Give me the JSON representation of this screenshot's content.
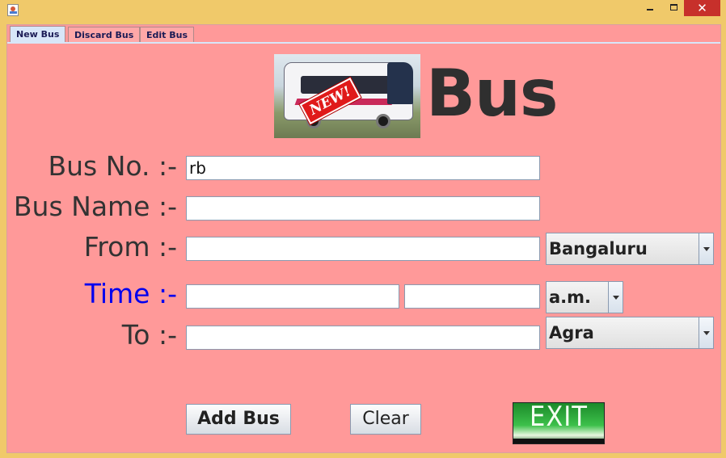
{
  "window": {
    "minimize_label": "_",
    "close_label": "✕"
  },
  "tabs": [
    {
      "label": "New Bus",
      "active": true
    },
    {
      "label": "Discard Bus",
      "active": false
    },
    {
      "label": "Edit Bus",
      "active": false
    }
  ],
  "heading": "Bus",
  "image": {
    "badge_text": "NEW!"
  },
  "form": {
    "bus_no": {
      "label": "Bus No. :-",
      "value": "rb"
    },
    "bus_name": {
      "label": "Bus Name :-",
      "value": ""
    },
    "from": {
      "label": "From :-",
      "value": "",
      "select": "Bangaluru"
    },
    "time": {
      "label": "Time :-",
      "hour": "",
      "minute": "",
      "meridiem": "a.m."
    },
    "to": {
      "label": "To :-",
      "value": "",
      "select": "Agra"
    }
  },
  "buttons": {
    "add": "Add Bus",
    "clear": "Clear",
    "exit": "EXIT"
  },
  "colors": {
    "window_bg": "#f0c96a",
    "panel_bg": "#ff9999",
    "time_label": "#0000ee",
    "close_button": "#c7302b"
  }
}
